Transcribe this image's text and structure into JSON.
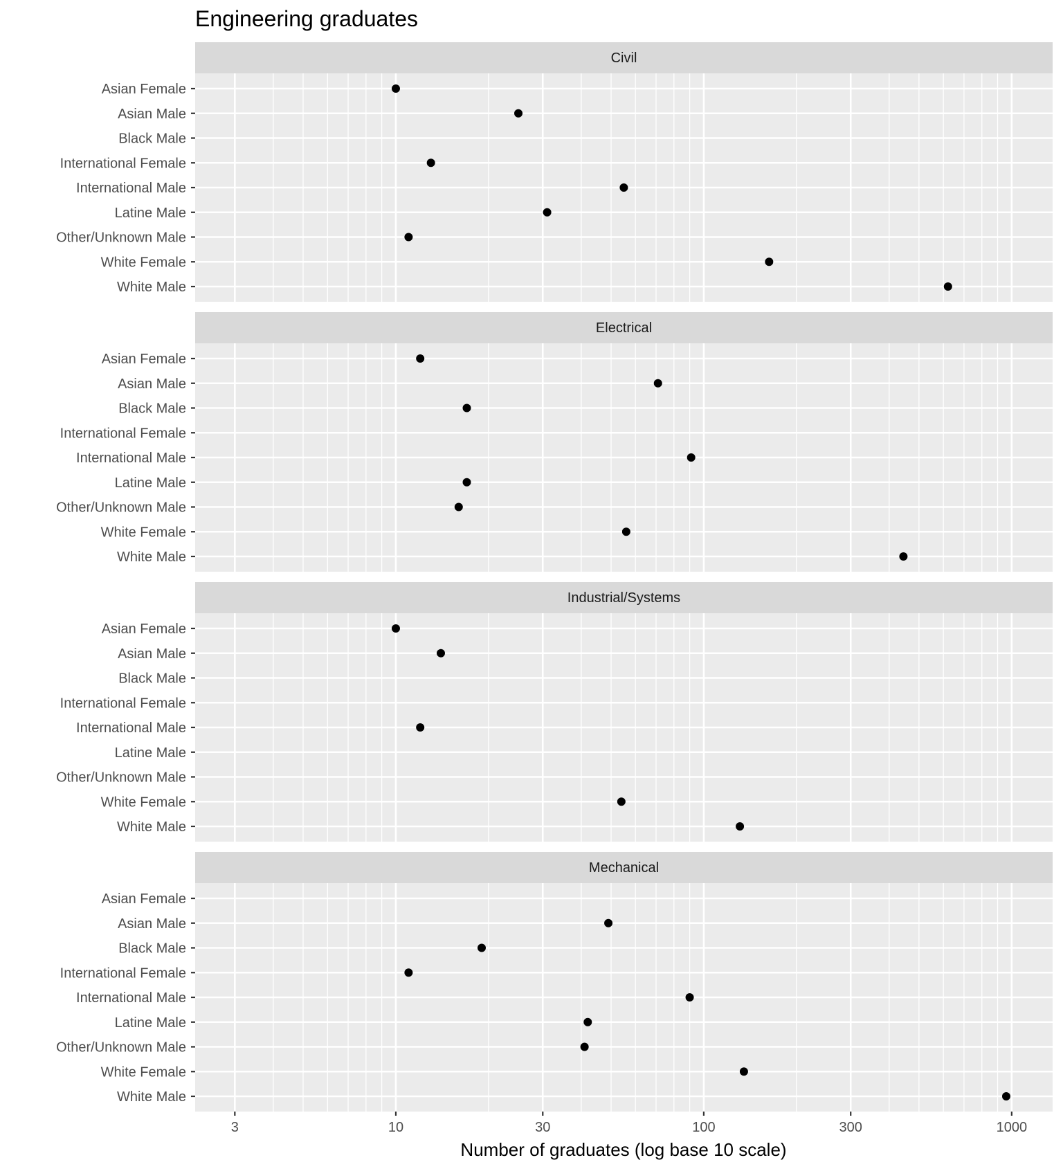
{
  "chart_data": {
    "type": "scatter",
    "title": "Engineering graduates",
    "xlabel": "Number of graduates (log base 10 scale)",
    "ylabel": "",
    "x_scale": "log10",
    "xlim": [
      2.23,
      1358
    ],
    "x_ticks": [
      3,
      10,
      30,
      100,
      300,
      1000
    ],
    "x_tick_labels": [
      "3",
      "10",
      "30",
      "100",
      "300",
      "1000"
    ],
    "grid": true,
    "legend": "none",
    "categories": [
      "Asian Female",
      "Asian Male",
      "Black Male",
      "International Female",
      "International Male",
      "Latine Male",
      "Other/Unknown Male",
      "White Female",
      "White Male"
    ],
    "facets": [
      {
        "name": "Civil",
        "values": [
          10,
          25,
          null,
          13,
          55,
          31,
          11,
          163,
          621
        ]
      },
      {
        "name": "Electrical",
        "values": [
          12,
          71,
          17,
          null,
          91,
          17,
          16,
          56,
          445
        ]
      },
      {
        "name": "Industrial/Systems",
        "values": [
          10,
          14,
          null,
          null,
          12,
          null,
          null,
          54,
          131
        ]
      },
      {
        "name": "Mechanical",
        "values": [
          null,
          49,
          19,
          11,
          90,
          42,
          41,
          135,
          960
        ]
      }
    ]
  },
  "colors": {
    "panel_bg": "#ebebeb",
    "strip_bg": "#d9d9d9",
    "grid": "#ffffff",
    "point": "#000000",
    "axis_text": "#4d4d4d"
  }
}
